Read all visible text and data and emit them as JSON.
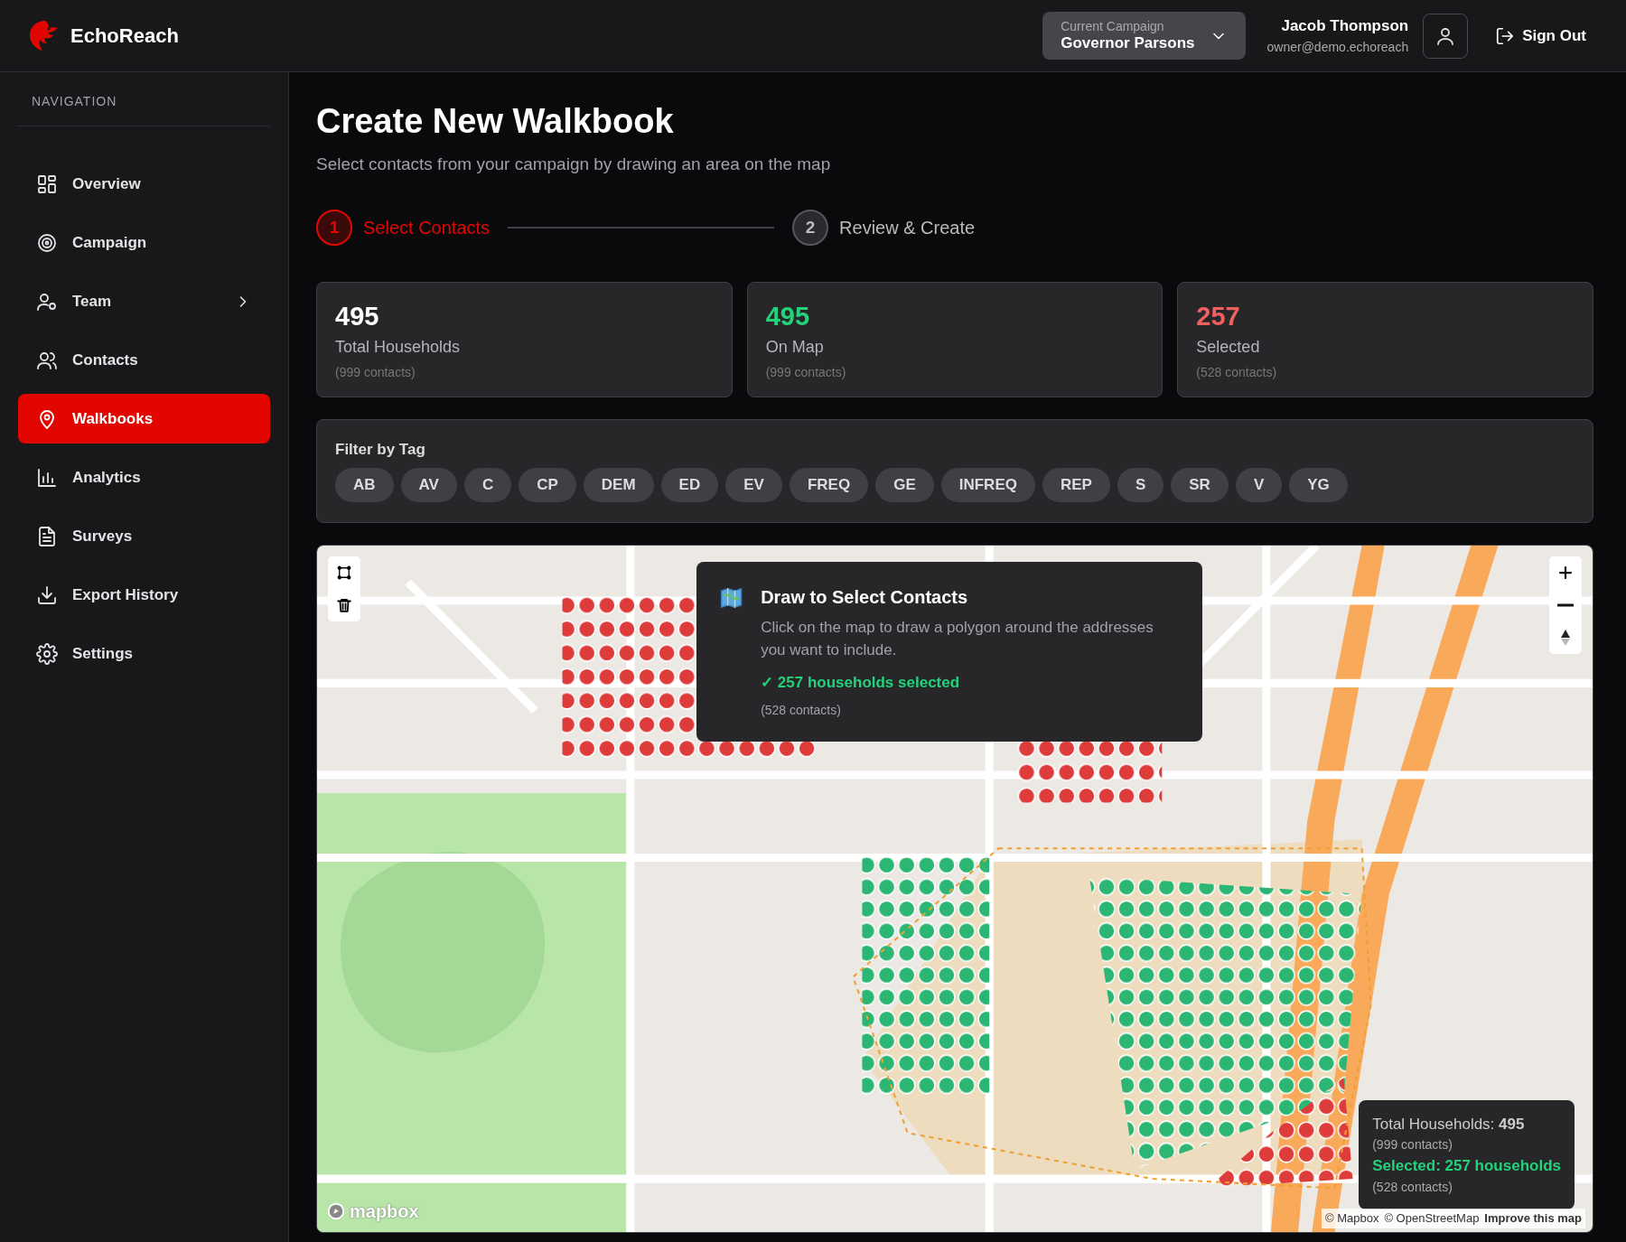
{
  "header": {
    "brand": "EchoReach",
    "campaign": {
      "label": "Current Campaign",
      "value": "Governor Parsons"
    },
    "user": {
      "name": "Jacob Thompson",
      "email": "owner@demo.echoreach"
    },
    "sign_out": "Sign Out"
  },
  "sidebar": {
    "heading": "NAVIGATION",
    "items": [
      {
        "label": "Overview",
        "selected": false,
        "has_children": false
      },
      {
        "label": "Campaign",
        "selected": false,
        "has_children": false
      },
      {
        "label": "Team",
        "selected": false,
        "has_children": true
      },
      {
        "label": "Contacts",
        "selected": false,
        "has_children": false
      },
      {
        "label": "Walkbooks",
        "selected": true,
        "has_children": false
      },
      {
        "label": "Analytics",
        "selected": false,
        "has_children": false
      },
      {
        "label": "Surveys",
        "selected": false,
        "has_children": false
      },
      {
        "label": "Export History",
        "selected": false,
        "has_children": false
      },
      {
        "label": "Settings",
        "selected": false,
        "has_children": false
      }
    ]
  },
  "page": {
    "title": "Create New Walkbook",
    "subtitle": "Select contacts from your campaign by drawing an area on the map",
    "steps": [
      {
        "number": "1",
        "label": "Select Contacts",
        "selected": true
      },
      {
        "number": "2",
        "label": "Review & Create",
        "selected": false
      }
    ]
  },
  "stats": [
    {
      "value": "495",
      "label": "Total Households",
      "sub": "(999 contacts)",
      "color": "#ffffff"
    },
    {
      "value": "495",
      "label": "On Map",
      "sub": "(999 contacts)",
      "color": "#22d37a"
    },
    {
      "value": "257",
      "label": "Selected",
      "sub": "(528 contacts)",
      "color": "#f25f5f"
    }
  ],
  "filter": {
    "title": "Filter by Tag",
    "tags": [
      {
        "label": "AB",
        "selected": false
      },
      {
        "label": "AV",
        "selected": false
      },
      {
        "label": "C",
        "selected": false
      },
      {
        "label": "CP",
        "selected": false
      },
      {
        "label": "DEM",
        "selected": false
      },
      {
        "label": "ED",
        "selected": false
      },
      {
        "label": "EV",
        "selected": false
      },
      {
        "label": "FREQ",
        "selected": false
      },
      {
        "label": "GE",
        "selected": false
      },
      {
        "label": "INFREQ",
        "selected": false
      },
      {
        "label": "REP",
        "selected": false
      },
      {
        "label": "S",
        "selected": false
      },
      {
        "label": "SR",
        "selected": false
      },
      {
        "label": "V",
        "selected": false
      },
      {
        "label": "YG",
        "selected": false
      }
    ]
  },
  "map": {
    "kind": "picture",
    "tooltip": {
      "title": "Draw to Select Contacts",
      "body": "Click on the map to draw a polygon around the addresses you want to include.",
      "status": "✓ 257 households selected",
      "contacts": "(528 contacts)"
    },
    "summary": {
      "total": "Total Households: **495**",
      "total_sub": "(999 contacts)",
      "selected": "Selected: 257 households",
      "selected_sub": "(528 contacts)"
    },
    "logo": "mapbox",
    "attribution": [
      "© Mapbox",
      "© OpenStreetMap",
      "Improve this map"
    ]
  }
}
